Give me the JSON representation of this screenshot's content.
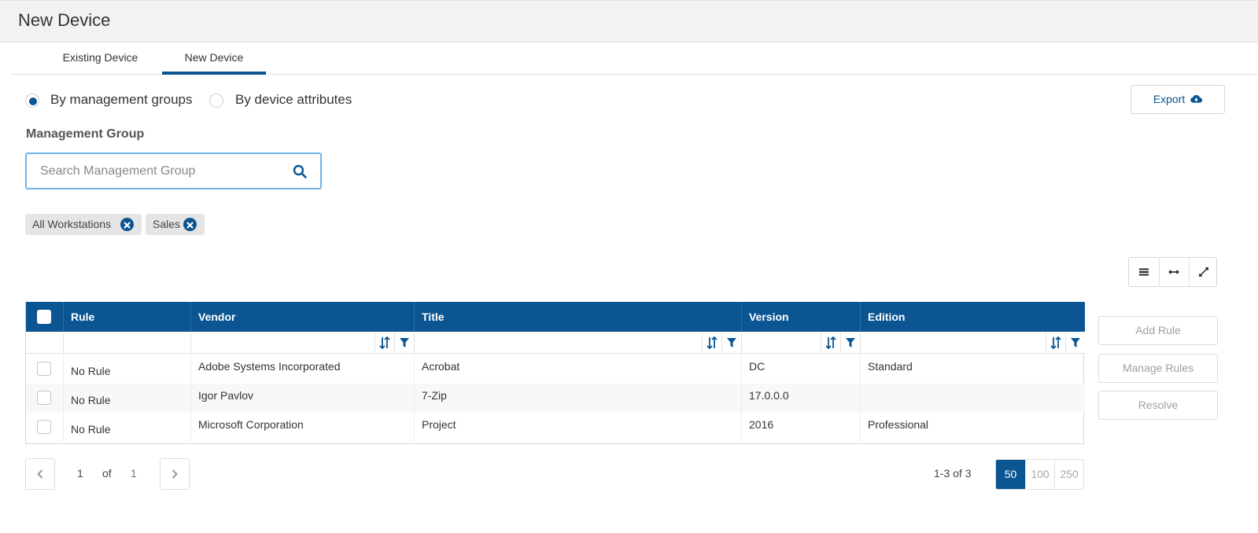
{
  "page": {
    "title": "New Device"
  },
  "tabs": [
    {
      "label": "Existing Device",
      "active": false
    },
    {
      "label": "New Device",
      "active": true
    }
  ],
  "mode": {
    "options": [
      {
        "label": "By management groups",
        "checked": true
      },
      {
        "label": "By device attributes",
        "checked": false
      }
    ]
  },
  "export": {
    "label": "Export",
    "icon": "cloud-download-icon"
  },
  "management_group": {
    "label": "Management Group",
    "search_placeholder": "Search Management Group",
    "search_value": ""
  },
  "chips": [
    {
      "label": "All Workstations",
      "icon": "remove-circle-icon"
    },
    {
      "label": "Sales",
      "icon": "remove-circle-icon"
    }
  ],
  "grid": {
    "columns": [
      {
        "label": "Rule",
        "sortable": false
      },
      {
        "label": "Vendor",
        "sortable": true
      },
      {
        "label": "Title",
        "sortable": true
      },
      {
        "label": "Version",
        "sortable": true
      },
      {
        "label": "Edition",
        "sortable": true
      }
    ],
    "rows": [
      {
        "rule": "No Rule",
        "vendor": "Adobe Systems Incorporated",
        "title": "Acrobat",
        "version": "DC",
        "edition": "Standard"
      },
      {
        "rule": "No Rule",
        "vendor": "Igor Pavlov",
        "title": "7-Zip",
        "version": "17.0.0.0",
        "edition": ""
      },
      {
        "rule": "No Rule",
        "vendor": "Microsoft Corporation",
        "title": "Project",
        "version": "2016",
        "edition": "Professional"
      }
    ]
  },
  "actions": {
    "add_rule": "Add Rule",
    "manage_rules": "Manage Rules",
    "resolve": "Resolve"
  },
  "pagination": {
    "current_page": "1",
    "of_label": "of",
    "total_pages": "1",
    "range": "1-3 of 3",
    "page_sizes": [
      {
        "label": "50",
        "active": true
      },
      {
        "label": "100",
        "active": false
      },
      {
        "label": "250",
        "active": false
      }
    ]
  },
  "colors": {
    "accent": "#0a5592",
    "focus_border": "#6fb3e8",
    "chip_bg": "#e5e5e5"
  }
}
